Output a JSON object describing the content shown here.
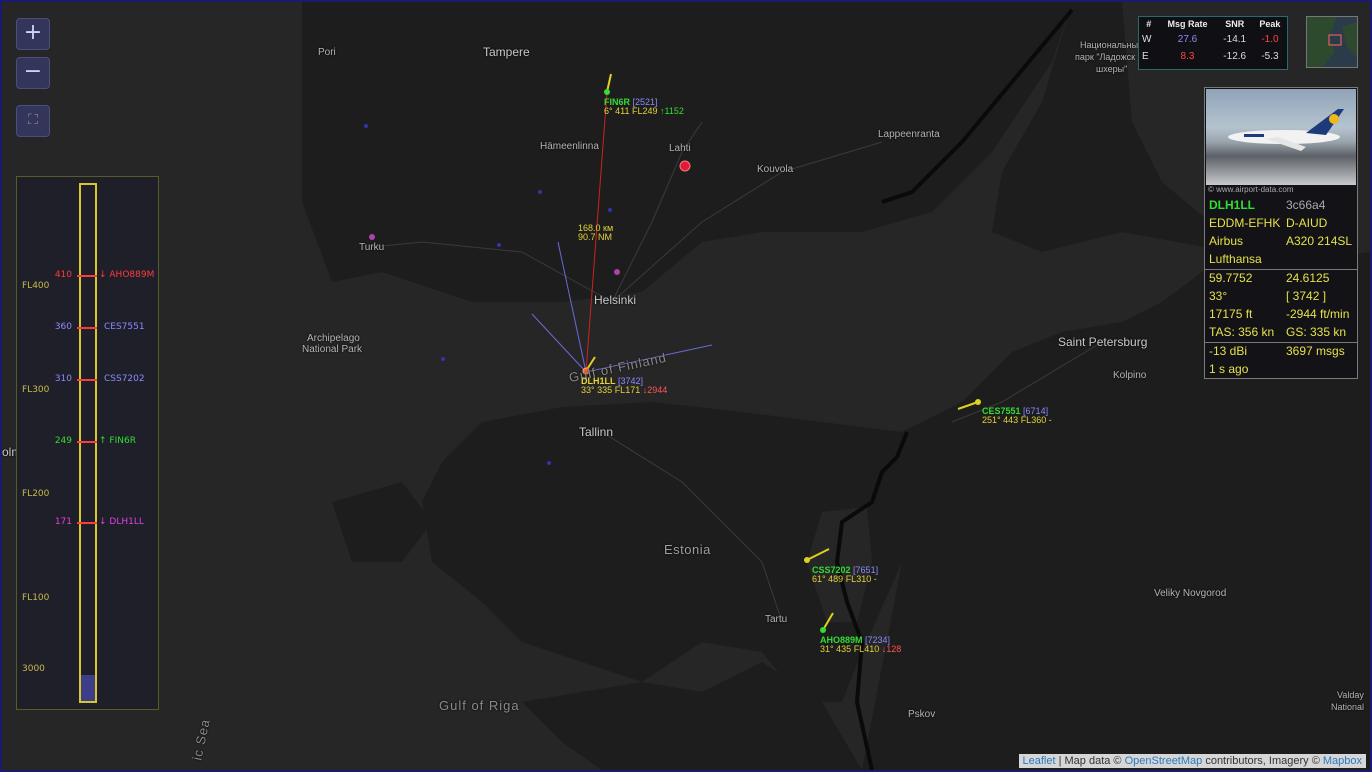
{
  "map": {
    "places": [
      {
        "name": "Pori",
        "cls": ""
      },
      {
        "name": "Tampere",
        "cls": "big"
      },
      {
        "name": "Hämeenlinna",
        "cls": ""
      },
      {
        "name": "Lahti",
        "cls": ""
      },
      {
        "name": "Kouvola",
        "cls": ""
      },
      {
        "name": "Lappeenranta",
        "cls": ""
      },
      {
        "name": "Turku",
        "cls": ""
      },
      {
        "name": "Helsinki",
        "cls": "big"
      },
      {
        "name": "Archipelago",
        "cls": ""
      },
      {
        "name": "National Park",
        "cls": ""
      },
      {
        "name": "Gulf of Finland",
        "cls": "sea"
      },
      {
        "name": "Tallinn",
        "cls": "big"
      },
      {
        "name": "Estonia",
        "cls": "country"
      },
      {
        "name": "Tartu",
        "cls": ""
      },
      {
        "name": "Gulf of Riga",
        "cls": "sea"
      },
      {
        "name": "Pskov",
        "cls": ""
      },
      {
        "name": "Saint Petersburg",
        "cls": "big"
      },
      {
        "name": "Kolpino",
        "cls": ""
      },
      {
        "name": "Veliky Novgorod",
        "cls": ""
      },
      {
        "name": "Национальный",
        "cls": ""
      },
      {
        "name": "парк \"Ладожск",
        "cls": ""
      },
      {
        "name": "шхеры\"",
        "cls": ""
      },
      {
        "name": "Valday",
        "cls": ""
      },
      {
        "name": "National",
        "cls": ""
      },
      {
        "name": "olm",
        "cls": "big"
      },
      {
        "name": "ic Sea",
        "cls": "sea"
      }
    ],
    "distance": {
      "km": "168.0 км",
      "nm": "90.7 NM"
    }
  },
  "aircraft": [
    {
      "callsign": "FIN6R",
      "squawk": "[2521]",
      "track": "6°",
      "speed": "411",
      "fl": "FL249",
      "rate": "↑1152",
      "rate_color": "#33dd33",
      "label_color": "#ffd54a",
      "dot": "#33dd33"
    },
    {
      "callsign": "DLH1LL",
      "squawk": "[3742]",
      "track": "33°",
      "speed": "335",
      "fl": "FL171",
      "rate": "↓2944",
      "rate_color": "#ff5555",
      "label_color": "#ffd54a",
      "dot": "#ff6633"
    },
    {
      "callsign": "CES7551",
      "squawk": "[6714]",
      "track": "251°",
      "speed": "443",
      "fl": "FL360",
      "rate": "-",
      "rate_color": "#ffd54a",
      "label_color": "#ffd54a",
      "dot": "#e0d020"
    },
    {
      "callsign": "CSS7202",
      "squawk": "[7651]",
      "track": "61°",
      "speed": "489",
      "fl": "FL310",
      "rate": "-",
      "rate_color": "#ffd54a",
      "label_color": "#ffd54a",
      "dot": "#e0d020"
    },
    {
      "callsign": "AHO889M",
      "squawk": "[7234]",
      "track": "31°",
      "speed": "435",
      "fl": "FL410",
      "rate": "↓128",
      "rate_color": "#ff5555",
      "label_color": "#ffd54a",
      "dot": "#33dd33"
    }
  ],
  "zoom": {
    "in": "+",
    "out": "−",
    "fit": "⛶"
  },
  "altitude_panel": {
    "flight_levels": [
      "FL400",
      "FL300",
      "FL200",
      "FL100",
      "3000"
    ],
    "entries": [
      {
        "value": "410",
        "label": "↓ AHO889M",
        "color": "#ff3b3b"
      },
      {
        "value": "360",
        "label": "CES7551",
        "color": "#8a8aff"
      },
      {
        "value": "310",
        "label": "CSS7202",
        "color": "#8a8aff"
      },
      {
        "value": "249",
        "label": "↑ FIN6R",
        "color": "#33dd33"
      },
      {
        "value": "171",
        "label": "↓ DLH1LL",
        "color": "#e040e0"
      }
    ]
  },
  "stats": {
    "headers": [
      "#",
      "Msg Rate",
      "SNR",
      "Peak"
    ],
    "rows": [
      {
        "id": "W",
        "rate": "27.6",
        "snr": "-14.1",
        "peak": "-1.0",
        "rate_color": "#8a8aff",
        "peak_color": "#ff4444"
      },
      {
        "id": "E",
        "rate": "8.3",
        "snr": "-12.6",
        "peak": "-5.3",
        "rate_color": "#ff4444",
        "peak_color": "#dddddd"
      }
    ]
  },
  "info": {
    "photo_credit": "© www.airport-data.com",
    "callsign": "DLH1LL",
    "hex": "3c66a4",
    "route": "EDDM-EFHK",
    "registration": "D-AIUD",
    "manufacturer": "Airbus",
    "type": "A320 214SL",
    "operator": "Lufthansa",
    "lat": "59.7752",
    "lon": "24.6125",
    "track": "33°",
    "squawk": "[ 3742 ]",
    "altitude": "17175 ft",
    "vrate": "-2944 ft/min",
    "tas": "TAS: 356 kn",
    "gs": "GS: 335 kn",
    "signal": "-13 dBi",
    "msgs": "3697 msgs",
    "age": "1 s ago"
  },
  "attribution": {
    "leaflet": "Leaflet",
    "sep1": " | Map data © ",
    "osm": "OpenStreetMap",
    "mid": " contributors, Imagery © ",
    "mapbox": "Mapbox"
  }
}
